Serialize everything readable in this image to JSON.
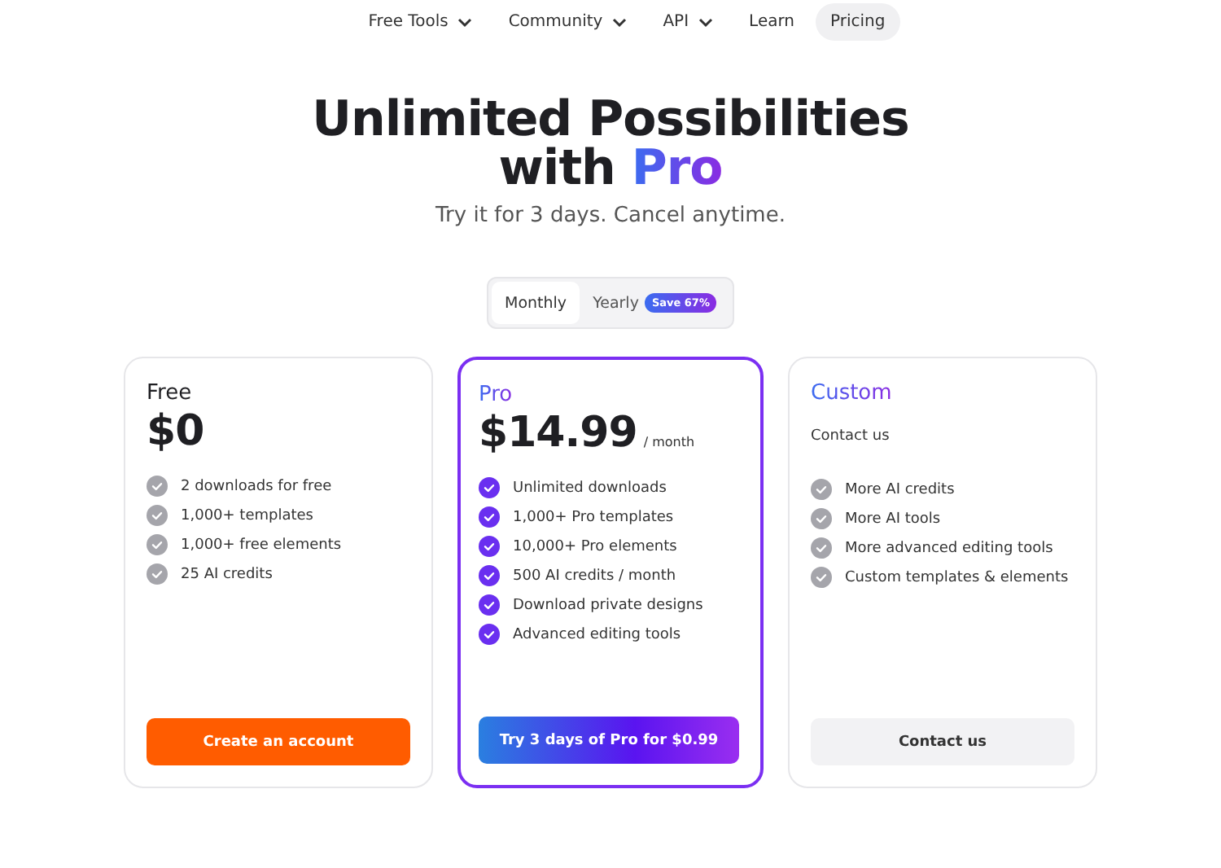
{
  "nav": [
    {
      "label": "Free Tools",
      "dropdown": true,
      "selected": false
    },
    {
      "label": "Community",
      "dropdown": true,
      "selected": false
    },
    {
      "label": "API",
      "dropdown": true,
      "selected": false
    },
    {
      "label": "Learn",
      "dropdown": false,
      "selected": false
    },
    {
      "label": "Pricing",
      "dropdown": false,
      "selected": true
    }
  ],
  "heading": {
    "text": "Unlimited Possibilities with",
    "highlight": "Pro"
  },
  "subtitle": "Try it for 3 days. Cancel anytime.",
  "billing": [
    {
      "label": "Monthly",
      "selected": true
    },
    {
      "label": "Yearly",
      "selected": false,
      "badge": "Save 67%"
    }
  ],
  "plans": [
    {
      "kind": "free",
      "name": "Free",
      "price": "$0",
      "features": [
        "2 downloads for free",
        "1,000+ templates",
        "1,000+ free elements",
        "25 AI credits"
      ],
      "button": "Create an account"
    },
    {
      "kind": "pro",
      "name": "Pro",
      "price": "$14.99",
      "period": "/ month",
      "features": [
        "Unlimited downloads",
        "1,000+ Pro templates",
        "10,000+ Pro elements",
        "500 AI credits / month",
        "Download private designs",
        "Advanced editing tools"
      ],
      "button": "Try 3 days of Pro for $0.99"
    },
    {
      "kind": "custom",
      "name": "Custom",
      "note": "Contact us",
      "features": [
        "More AI credits",
        "More AI tools",
        "More advanced editing tools",
        "Custom templates & elements"
      ],
      "button": "Contact us"
    }
  ]
}
